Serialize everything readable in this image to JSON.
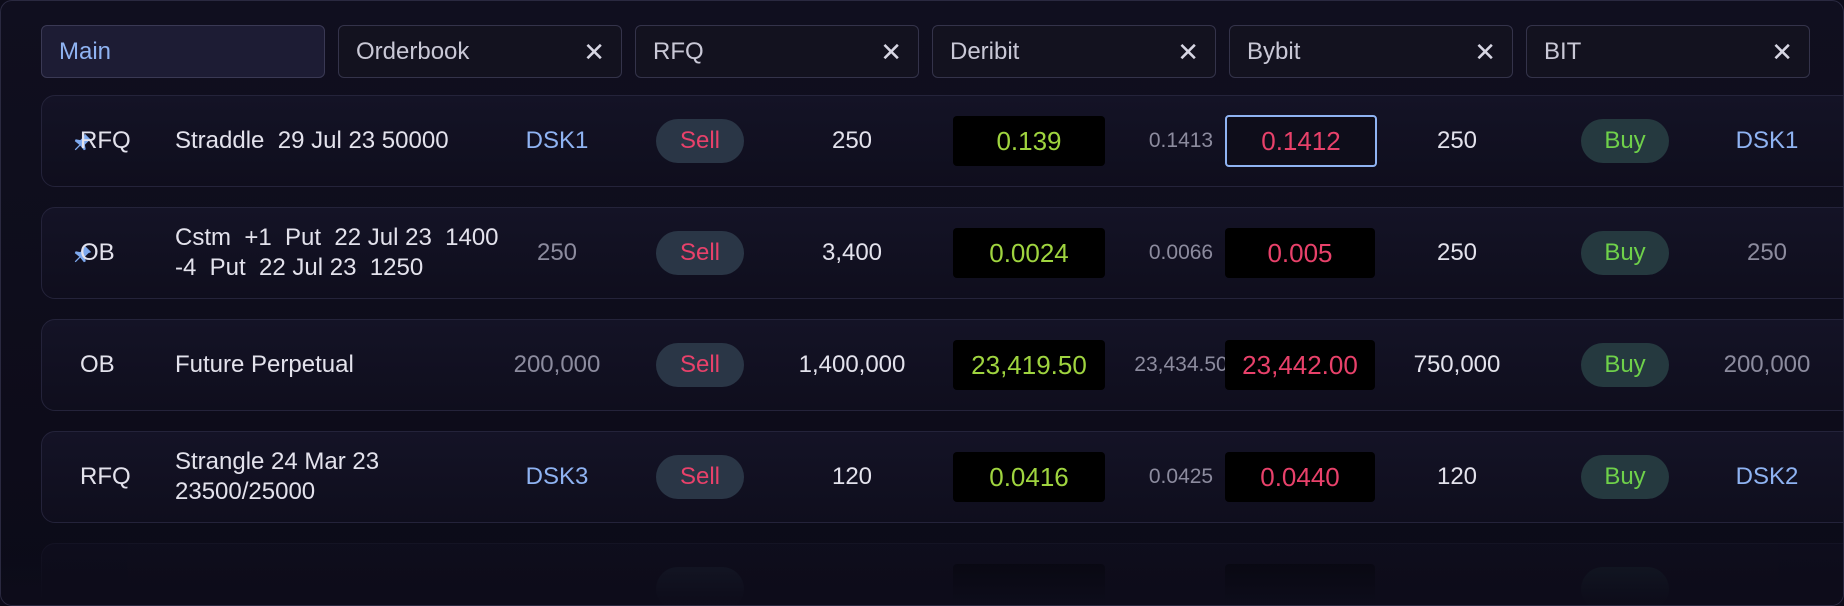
{
  "tabs": [
    {
      "label": "Main",
      "closable": false,
      "active": true
    },
    {
      "label": "Orderbook",
      "closable": true
    },
    {
      "label": "RFQ",
      "closable": true
    },
    {
      "label": "Deribit",
      "closable": true
    },
    {
      "label": "Bybit",
      "closable": true
    },
    {
      "label": "BIT",
      "closable": true
    }
  ],
  "close_glyph": "✕",
  "icons": {
    "pin": "pin-icon"
  },
  "colors": {
    "sell": "#e8416a",
    "buy": "#6fd14a",
    "bid": "#9fd43f",
    "ask": "#e8416a",
    "accent": "#8fb3f2"
  },
  "rows": [
    {
      "pinned": true,
      "type": "RFQ",
      "instrument": "Straddle  29 Jul 23 50000",
      "left_value": "DSK1",
      "left_is_desk": true,
      "sell_label": "Sell",
      "bid_qty": "250",
      "bid": "0.139",
      "mid": "0.1413",
      "ask": "0.1412",
      "ask_focused": true,
      "ask_qty": "250",
      "buy_label": "Buy",
      "right_value": "DSK1",
      "right_is_desk": true
    },
    {
      "pinned": true,
      "type": "OB",
      "instrument": "Cstm  +1  Put  22 Jul 23  1400\n-4  Put  22 Jul 23  1250",
      "left_value": "250",
      "left_is_desk": false,
      "sell_label": "Sell",
      "bid_qty": "3,400",
      "bid": "0.0024",
      "mid": "0.0066",
      "ask": "0.005",
      "ask_focused": false,
      "ask_qty": "250",
      "buy_label": "Buy",
      "right_value": "250",
      "right_is_desk": false
    },
    {
      "pinned": false,
      "type": "OB",
      "instrument": "Future Perpetual",
      "left_value": "200,000",
      "left_is_desk": false,
      "sell_label": "Sell",
      "bid_qty": "1,400,000",
      "bid": "23,419.50",
      "mid": "23,434.50",
      "ask": "23,442.00",
      "ask_focused": false,
      "ask_qty": "750,000",
      "buy_label": "Buy",
      "right_value": "200,000",
      "right_is_desk": false
    },
    {
      "pinned": false,
      "type": "RFQ",
      "instrument": "Strangle 24 Mar 23\n23500/25000",
      "left_value": "DSK3",
      "left_is_desk": true,
      "sell_label": "Sell",
      "bid_qty": "120",
      "bid": "0.0416",
      "mid": "0.0425",
      "ask": "0.0440",
      "ask_focused": false,
      "ask_qty": "120",
      "buy_label": "Buy",
      "right_value": "DSK2",
      "right_is_desk": true
    }
  ]
}
